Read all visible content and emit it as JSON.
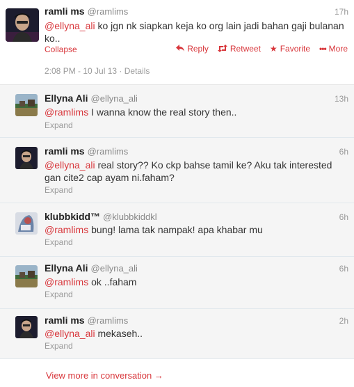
{
  "main_tweet": {
    "name": "ramli ms",
    "handle": "@ramlims",
    "time": "17h",
    "mention": "@ellyna_ali",
    "text_line1_rest": " ko jgn nk siapkan keja ko org lain jadi bahan gaji bulanan",
    "text_line2": "ko..",
    "collapse_label": "Collapse",
    "actions": {
      "reply": "Reply",
      "retweet": "Retweet",
      "favorite": "Favorite",
      "more": "More"
    },
    "timestamp": "2:08 PM - 10 Jul 13",
    "details_label": "Details"
  },
  "replies": [
    {
      "name": "Ellyna Ali",
      "handle": "@ellyna_ali",
      "time": "13h",
      "mention": "@ramlims",
      "line1_rest": " I wanna know the real story then..",
      "line2": "",
      "expand": "Expand"
    },
    {
      "name": "ramli ms",
      "handle": "@ramlims",
      "time": "6h",
      "mention": "@ellyna_ali",
      "line1_rest": " real story?? Ko ckp bahse tamil ke? Aku tak interested",
      "line2": "gan cite2 cap ayam ni.faham?",
      "expand": "Expand"
    },
    {
      "name": "klubbkidd™",
      "handle": "@klubbkiddkl",
      "time": "6h",
      "mention": "@ramlims",
      "line1_rest": " bung! lama tak nampak! apa khabar mu",
      "line2": "",
      "expand": "Expand"
    },
    {
      "name": "Ellyna Ali",
      "handle": "@ellyna_ali",
      "time": "6h",
      "mention": "@ramlims",
      "line1_rest": " ok ..faham",
      "line2": "",
      "expand": "Expand"
    },
    {
      "name": "ramli ms",
      "handle": "@ramlims",
      "time": "2h",
      "mention": "@ellyna_ali",
      "line1_rest": " mekaseh..",
      "line2": "",
      "expand": "Expand"
    }
  ],
  "view_more": "View more in conversation →"
}
